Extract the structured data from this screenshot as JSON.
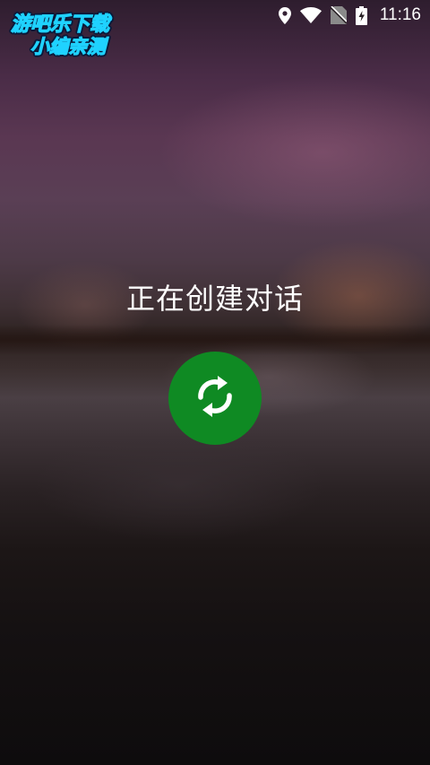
{
  "status_bar": {
    "time": "11:16",
    "icons": [
      "location-icon",
      "wifi-icon",
      "no-sim-icon",
      "battery-charging-icon"
    ]
  },
  "watermark": {
    "line1": "游吧乐下载",
    "line2": "小编亲测"
  },
  "main": {
    "title": "正在创建对话",
    "spinner_icon": "sync-icon"
  },
  "colors": {
    "accent_green": "#0f8a23",
    "text": "#ffffff",
    "watermark_cyan": "#1fd2ff"
  }
}
